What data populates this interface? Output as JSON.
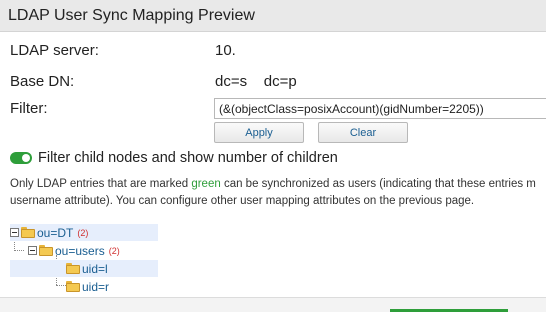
{
  "window": {
    "title": "LDAP User Sync Mapping Preview"
  },
  "fields": {
    "server_label": "LDAP server:",
    "server_value": "10.",
    "basedn_label": "Base DN:",
    "basedn_value": "dc=s    dc=p",
    "filter_label": "Filter:",
    "filter_value": "(&(objectClass=posixAccount)(gidNumber=2205))"
  },
  "buttons": {
    "apply": "Apply",
    "clear": "Clear"
  },
  "toggle": {
    "on": true,
    "label": "Filter child nodes and show number of children"
  },
  "info": {
    "part1": "Only LDAP entries that are marked ",
    "green_word": "green",
    "part2": " can be synchronized as users (indicating that these entries m",
    "line2": "username attribute). You can configure other user mapping attributes on the previous page."
  },
  "tree": {
    "root": {
      "label": "ou=DT",
      "count": "(2)"
    },
    "child": {
      "label": "ou=users",
      "count": "(2)"
    },
    "leaves": [
      {
        "label": "uid=l"
      },
      {
        "label": "uid=r"
      }
    ]
  },
  "colors": {
    "accent_green": "#2e9e3a",
    "link_blue": "#1a5e91",
    "count_red": "#d03030"
  }
}
